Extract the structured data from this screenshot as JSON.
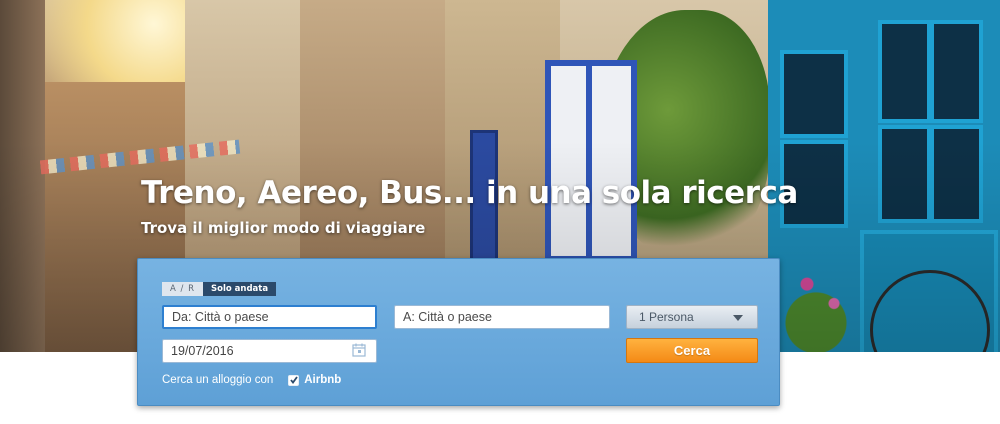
{
  "hero": {
    "headline": "Treno, Aereo, Bus... in una sola ricerca",
    "subheadline": "Trova il miglior modo di viaggiare"
  },
  "search": {
    "trip_type": {
      "round_trip_label": "A / R",
      "one_way_label": "Solo andata",
      "selected": "Solo andata"
    },
    "from": {
      "placeholder": "Da: Città o paese",
      "value": ""
    },
    "to": {
      "placeholder": "A: Città o paese",
      "value": ""
    },
    "date": {
      "value": "19/07/2016",
      "icon": "calendar-icon"
    },
    "passengers": {
      "value": "1 Persona",
      "icon": "chevron-down-icon"
    },
    "submit_label": "Cerca",
    "lodging": {
      "label": "Cerca un alloggio con",
      "checked": true,
      "partner": "Airbnb"
    }
  },
  "colors": {
    "panel": "#6aa9dc",
    "search_button": "#f7941d",
    "selected_tab": "#2b4a6b",
    "focus_border": "#2d7fd0"
  }
}
